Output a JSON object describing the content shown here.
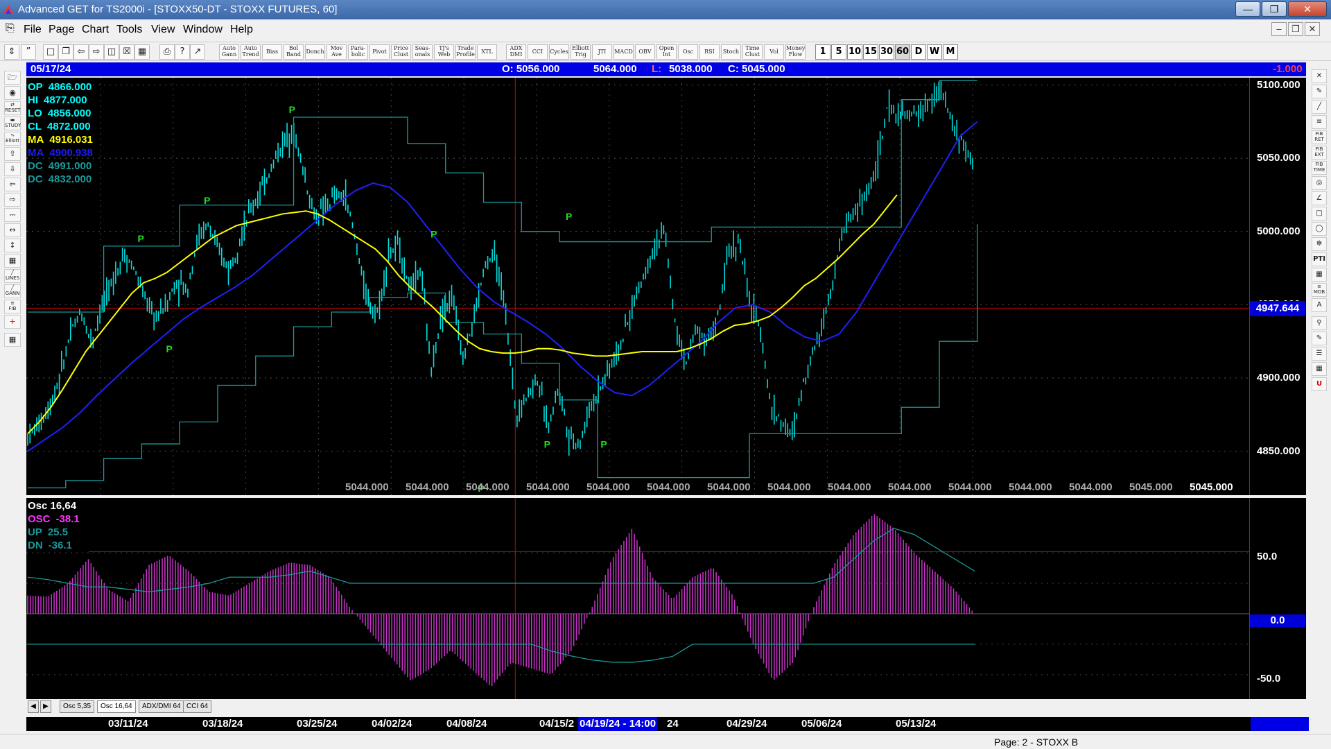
{
  "window": {
    "title": "Advanced GET for TS2000i - [STOXX50-DT - STOXX FUTURES, 60]"
  },
  "menu": [
    "File",
    "Page",
    "Chart",
    "Tools",
    "View",
    "Window",
    "Help"
  ],
  "toolbar": {
    "studies": [
      {
        "l1": "Auto",
        "l2": "Gann"
      },
      {
        "l1": "Auto",
        "l2": "Trend"
      },
      {
        "l1": "Bias",
        "l2": ""
      },
      {
        "l1": "Bol",
        "l2": "Band"
      },
      {
        "l1": "Donch",
        "l2": ""
      },
      {
        "l1": "Mov",
        "l2": "Ave"
      },
      {
        "l1": "Para-",
        "l2": "bolic"
      },
      {
        "l1": "Pivot",
        "l2": ""
      },
      {
        "l1": "Price",
        "l2": "Clust"
      },
      {
        "l1": "Seas-",
        "l2": "onals"
      },
      {
        "l1": "TJ's",
        "l2": "Web"
      },
      {
        "l1": "Trade",
        "l2": "Profile"
      },
      {
        "l1": "XTL",
        "l2": ""
      }
    ],
    "indicators": [
      {
        "l1": "ADX",
        "l2": "DMI"
      },
      {
        "l1": "CCI",
        "l2": ""
      },
      {
        "l1": "Cycles",
        "l2": ""
      },
      {
        "l1": "Elliott",
        "l2": "Trig"
      },
      {
        "l1": "JTI",
        "l2": ""
      },
      {
        "l1": "MACD",
        "l2": ""
      },
      {
        "l1": "OBV",
        "l2": ""
      },
      {
        "l1": "Open",
        "l2": "Int"
      },
      {
        "l1": "Osc",
        "l2": ""
      },
      {
        "l1": "RSI",
        "l2": ""
      },
      {
        "l1": "Stoch",
        "l2": ""
      },
      {
        "l1": "Time",
        "l2": "Clust"
      },
      {
        "l1": "Vol",
        "l2": ""
      },
      {
        "l1": "Money",
        "l2": "Flow"
      }
    ],
    "timeframes": [
      "1",
      "5",
      "10",
      "15",
      "30",
      "60",
      "D",
      "W",
      "M"
    ],
    "selected_timeframe": "60"
  },
  "infobar": {
    "date": "05/17/24",
    "open": "O: 5056.000",
    "high": "5064.000",
    "low_label": "L:",
    "low": "5038.000",
    "close": "C: 5045.000",
    "change": "-1.000"
  },
  "legend": [
    {
      "label": "OP",
      "value": "4866.000",
      "color": "#00ffff"
    },
    {
      "label": "HI",
      "value": "4877.000",
      "color": "#00ffff"
    },
    {
      "label": "LO",
      "value": "4856.000",
      "color": "#00ffff"
    },
    {
      "label": "CL",
      "value": "4872.000",
      "color": "#00ffff"
    },
    {
      "label": "MA",
      "value": "4916.031",
      "color": "#ffff00"
    },
    {
      "label": "MA",
      "value": "4900.938",
      "color": "#1a1aff"
    },
    {
      "label": "DC",
      "value": "4991.000",
      "color": "#1a9a9a"
    },
    {
      "label": "DC",
      "value": "4832.000",
      "color": "#1a9a9a"
    }
  ],
  "price_axis": {
    "ticks": [
      "5100.000",
      "5050.000",
      "5000.000",
      "4950.000",
      "4900.000",
      "4850.000"
    ],
    "current": "4947.644",
    "scale_min": 4820,
    "scale_max": 5105
  },
  "bottom_value_labels": [
    "5044.000",
    "5044.000",
    "5044.000",
    "5044.000",
    "5044.000",
    "5044.000",
    "5044.000",
    "5044.000",
    "5044.000",
    "5044.000",
    "5044.000",
    "5044.000",
    "5044.000",
    "5045.000",
    "5045.000"
  ],
  "pivots": [
    {
      "label": "P",
      "type": "high",
      "t": 0.12,
      "v": 4990
    },
    {
      "label": "P",
      "type": "low",
      "t": 0.15,
      "v": 4925
    },
    {
      "label": "P",
      "type": "high",
      "t": 0.19,
      "v": 5016
    },
    {
      "label": "P",
      "type": "high",
      "t": 0.28,
      "v": 5078
    },
    {
      "label": "P",
      "type": "high",
      "t": 0.43,
      "v": 4993
    },
    {
      "label": "P",
      "type": "low",
      "t": 0.48,
      "v": 4830
    },
    {
      "label": "P",
      "type": "low",
      "t": 0.55,
      "v": 4860
    },
    {
      "label": "P",
      "type": "high",
      "t": 0.573,
      "v": 5005
    },
    {
      "label": "P",
      "type": "low",
      "t": 0.61,
      "v": 4860
    }
  ],
  "oscillator": {
    "legend": [
      {
        "label": "Osc 16,64",
        "value": "",
        "color": "#ffffff"
      },
      {
        "label": "OSC",
        "value": "-38.1",
        "color": "#ff33ff"
      },
      {
        "label": "UP",
        "value": "25.5",
        "color": "#1a9a9a"
      },
      {
        "label": "DN",
        "value": "-36.1",
        "color": "#1a9a9a"
      }
    ],
    "ticks": [
      "50.0",
      "0.0",
      "-50.0"
    ],
    "zero_label": "0.0",
    "scale_min": -70,
    "scale_max": 95
  },
  "tabs": [
    "Osc 5,35",
    "Osc 16,64",
    "ADX/DMI 64",
    "CCI 64"
  ],
  "selected_tab": "Osc 16,64",
  "date_axis": {
    "labels": [
      "03/11/24",
      "03/18/24",
      "03/25/24",
      "04/02/24",
      "04/08/24",
      "04/15/2",
      "24",
      "04/29/24",
      "05/06/24",
      "05/13/24"
    ],
    "cursor": "04/19/24 - 14:00"
  },
  "status": {
    "page": "Page: 2 - STOXX B"
  },
  "colors": {
    "bars": "#00e0e0",
    "ma_fast": "#ffff00",
    "ma_slow": "#2020ff",
    "donchian": "#1a9a9a",
    "pivot": "#22dd22",
    "osc": "#cc33cc",
    "cursor": "#cc0000"
  },
  "chart_data": {
    "type": "line",
    "series": [
      {
        "name": "Close",
        "values": [
          4860,
          4868,
          4880,
          4900,
          4930,
          4945,
          4925,
          4950,
          4965,
          4985,
          4975,
          4955,
          4940,
          4950,
          4965,
          4960,
          4995,
          5005,
          4985,
          4975,
          4995,
          5015,
          5028,
          5045,
          5060,
          5070,
          5040,
          5010,
          5015,
          5025,
          5022,
          4990,
          4950,
          4945,
          4985,
          4990,
          4960,
          4975,
          4905,
          4945,
          4955,
          4915,
          4940,
          4975,
          4985,
          4945,
          4875,
          4888,
          4900,
          4865,
          4895,
          4860,
          4855,
          4880,
          4895,
          4910,
          4925,
          4950,
          4970,
          4990,
          5000,
          4935,
          4910,
          4935,
          4925,
          4940,
          4985,
          4995,
          4950,
          4935,
          4880,
          4870,
          4860,
          4895,
          4920,
          4940,
          4975,
          5005,
          5015,
          5025,
          5045,
          5085,
          5080,
          5078,
          5082,
          5088,
          5098,
          5075,
          5060,
          5046
        ]
      },
      {
        "name": "MA",
        "values": [
          4862,
          4870,
          4880,
          4892,
          4905,
          4918,
          4928,
          4938,
          4948,
          4958,
          4965,
          4968,
          4972,
          4978,
          4984,
          4990,
          4996,
          5000,
          5004,
          5006,
          5008,
          5010,
          5012,
          5013,
          5014,
          5012,
          5008,
          5003,
          4998,
          4993,
          4988,
          4980,
          4970,
          4962,
          4955,
          4948,
          4940,
          4932,
          4925,
          4920,
          4918,
          4917,
          4917,
          4918,
          4920,
          4920,
          4919,
          4917,
          4916,
          4915,
          4915,
          4916,
          4917,
          4918,
          4918,
          4918,
          4918,
          4920,
          4923,
          4927,
          4932,
          4936,
          4937,
          4939,
          4942,
          4948,
          4955,
          4963,
          4968,
          4975,
          4982,
          4990,
          4998,
          5005,
          5015,
          5025
        ]
      },
      {
        "name": "MA slow",
        "values": [
          4850,
          4858,
          4866,
          4876,
          4888,
          4899,
          4910,
          4920,
          4930,
          4940,
          4948,
          4955,
          4962,
          4970,
          4980,
          4990,
          5000,
          5010,
          5020,
          5028,
          5033,
          5030,
          5020,
          5005,
          4990,
          4975,
          4962,
          4952,
          4945,
          4938,
          4930,
          4920,
          4908,
          4898,
          4890,
          4888,
          4895,
          4905,
          4915,
          4925,
          4938,
          4948,
          4950,
          4945,
          4935,
          4928,
          4925,
          4930,
          4945,
          4965,
          4985,
          5005,
          5025,
          5045,
          5065,
          5075
        ]
      },
      {
        "name": "DC upper",
        "values": [
          4945,
          4945,
          4990,
          4990,
          5018,
          5018,
          5018,
          5078,
          5078,
          5078,
          5060,
          5040,
          5020,
          5000,
          4993,
          4993,
          4993,
          4993,
          5003,
          5003,
          5003,
          5003,
          5003,
          5090,
          5103,
          5103
        ]
      },
      {
        "name": "DC lower",
        "values": [
          4825,
          4830,
          4845,
          4855,
          4870,
          4895,
          4915,
          4935,
          4945,
          4955,
          4958,
          4938,
          4930,
          4910,
          4885,
          4832,
          4832,
          4832,
          4832,
          4862,
          4862,
          4862,
          4862,
          4880,
          4925,
          5005
        ]
      }
    ]
  }
}
